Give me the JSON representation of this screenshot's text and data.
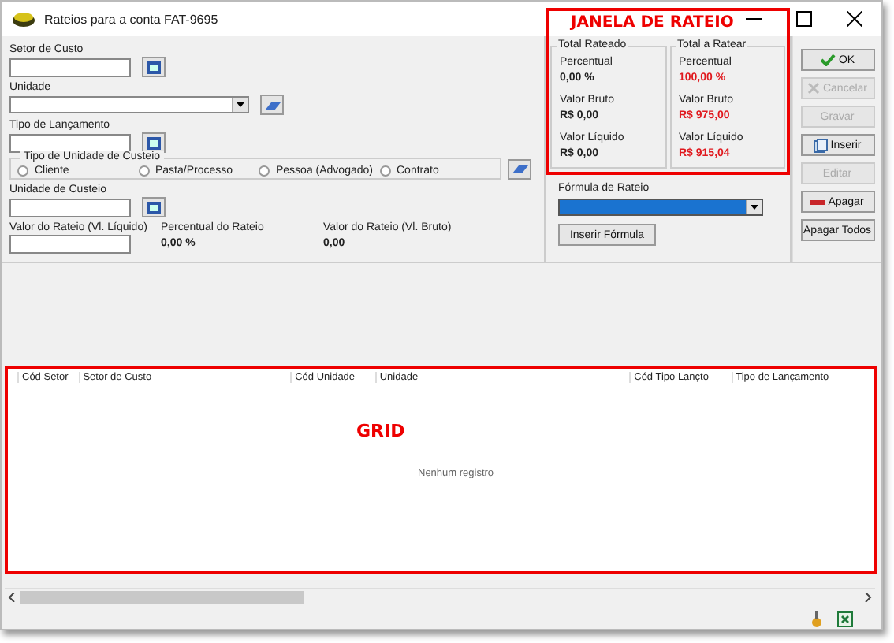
{
  "window": {
    "title": "Rateios para a conta FAT-9695"
  },
  "form": {
    "setor_de_custo": {
      "label": "Setor de Custo"
    },
    "unidade": {
      "label": "Unidade"
    },
    "tipo_de_lancamento": {
      "label": "Tipo de Lançamento"
    },
    "tipo_unidade_custeio": {
      "legend": "Tipo de Unidade de Custeio",
      "options": [
        {
          "label": "Cliente",
          "checked": false
        },
        {
          "label": "Pasta/Processo",
          "checked": false
        },
        {
          "label": "Pessoa (Advogado)",
          "checked": false
        },
        {
          "label": "Contrato",
          "checked": false
        }
      ]
    },
    "unidade_de_custeio": {
      "label": "Unidade de Custeio"
    },
    "valor_rateio_liquido": {
      "label": "Valor do Rateio (Vl. Líquido)"
    },
    "percentual_do_rateio": {
      "label": "Percentual do Rateio",
      "value": "0,00 %"
    },
    "valor_rateio_bruto": {
      "label": "Valor do Rateio (Vl. Bruto)",
      "value": "0,00"
    }
  },
  "rateio": {
    "groups": [
      {
        "legend": "Total Rateado",
        "highlight": false,
        "items": [
          {
            "label": "Percentual",
            "value": "0,00 %"
          },
          {
            "label": "Valor Bruto",
            "value": "R$ 0,00"
          },
          {
            "label": "Valor Líquido",
            "value": "R$ 0,00"
          }
        ]
      },
      {
        "legend": "Total a Ratear",
        "highlight": true,
        "items": [
          {
            "label": "Percentual",
            "value": "100,00 %"
          },
          {
            "label": "Valor Bruto",
            "value": "R$ 975,00"
          },
          {
            "label": "Valor Líquido",
            "value": "R$ 915,04"
          }
        ]
      }
    ],
    "formula_label": "Fórmula de Rateio",
    "formula_button": "Inserir Fórmula"
  },
  "buttons": [
    {
      "label": "OK",
      "kind": "ok",
      "disabled": false
    },
    {
      "label": "Cancelar",
      "kind": "cancel",
      "disabled": true
    },
    {
      "label": "Gravar",
      "kind": "plain",
      "disabled": true
    },
    {
      "label": "Inserir",
      "kind": "insert",
      "disabled": false
    },
    {
      "label": "Editar",
      "kind": "plain",
      "disabled": true
    },
    {
      "label": "Apagar",
      "kind": "delete",
      "disabled": false
    },
    {
      "label": "Apagar Todos",
      "kind": "plain",
      "disabled": false
    }
  ],
  "grid": {
    "columns": [
      "Cód Setor",
      "Setor de Custo",
      "Cód Unidade",
      "Unidade",
      "Cód Tipo Lançto",
      "Tipo de Lançamento"
    ],
    "empty_text": "Nenhum registro"
  },
  "annotations": {
    "rateio_window": "JANELA DE RATEIO",
    "grid": "GRID"
  }
}
